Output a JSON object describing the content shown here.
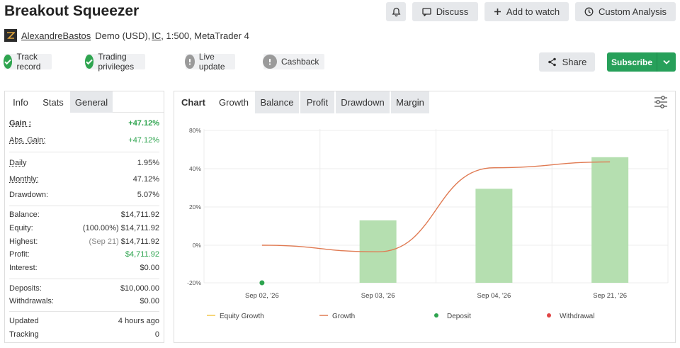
{
  "header": {
    "title": "Breakout Squeezer",
    "buttons": {
      "discuss": "Discuss",
      "add_to_watch": "Add to watch",
      "custom_analysis": "Custom Analysis"
    }
  },
  "account": {
    "author": "AlexandreBastos",
    "type": "Demo (USD),",
    "broker": "IC",
    "details": ", 1:500, MetaTrader 4"
  },
  "badges": [
    "Track record",
    "Trading privileges",
    "Live update",
    "Cashback"
  ],
  "actions": {
    "share": "Share",
    "subscribe": "Subscribe"
  },
  "left_panel": {
    "tabs": [
      "Info",
      "Stats",
      "General"
    ],
    "stats": {
      "gain_label": "Gain :",
      "gain": "+47.12%",
      "abs_gain_label": "Abs. Gain:",
      "abs_gain": "+47.12%",
      "daily_label": "Daily",
      "daily": "1.95%",
      "monthly_label": "Monthly:",
      "monthly": "47.12%",
      "drawdown_label": "Drawdown:",
      "drawdown": "5.07%",
      "balance_label": "Balance:",
      "balance": "$14,711.92",
      "equity_label": "Equity:",
      "equity_pct": "(100.00%)",
      "equity": "$14,711.92",
      "highest_label": "Highest:",
      "highest_date": "(Sep 21)",
      "highest": "$14,711.92",
      "profit_label": "Profit:",
      "profit": "$4,711.92",
      "interest_label": "Interest:",
      "interest": "$0.00",
      "deposits_label": "Deposits:",
      "deposits": "$10,000.00",
      "withdrawals_label": "Withdrawals:",
      "withdrawals": "$0.00",
      "updated_label": "Updated",
      "updated": "4 hours ago",
      "tracking_label": "Tracking",
      "tracking": "0"
    }
  },
  "chart_tabs": [
    "Chart",
    "Growth",
    "Balance",
    "Profit",
    "Drawdown",
    "Margin"
  ],
  "chart_data": {
    "type": "bar",
    "categories": [
      "Sep 02, '26",
      "Sep 03, '26",
      "Sep 04, '26",
      "Sep 21, '26"
    ],
    "y_ticks": [
      "80%",
      "40%",
      "20%",
      "0%",
      "-20%"
    ],
    "ylim": [
      -20,
      80
    ],
    "series": [
      {
        "name": "Growth",
        "type": "bar",
        "values": [
          0,
          13,
          29.5,
          52
        ],
        "color": "#b5dfb0"
      },
      {
        "name": "Growth",
        "type": "line",
        "values": [
          0,
          -3.5,
          41,
          47.12
        ],
        "color": "#e07a52"
      },
      {
        "name": "Deposit",
        "type": "scatter",
        "values": [
          -20,
          null,
          null,
          null
        ],
        "color": "#2ea44f"
      }
    ],
    "legend": [
      "Equity Growth",
      "Growth",
      "Deposit",
      "Withdrawal"
    ],
    "legend_colors": [
      "#f2c94c",
      "#e07a52",
      "#2ea44f",
      "#e04545"
    ],
    "grid": true,
    "legend_position": "bottom"
  }
}
